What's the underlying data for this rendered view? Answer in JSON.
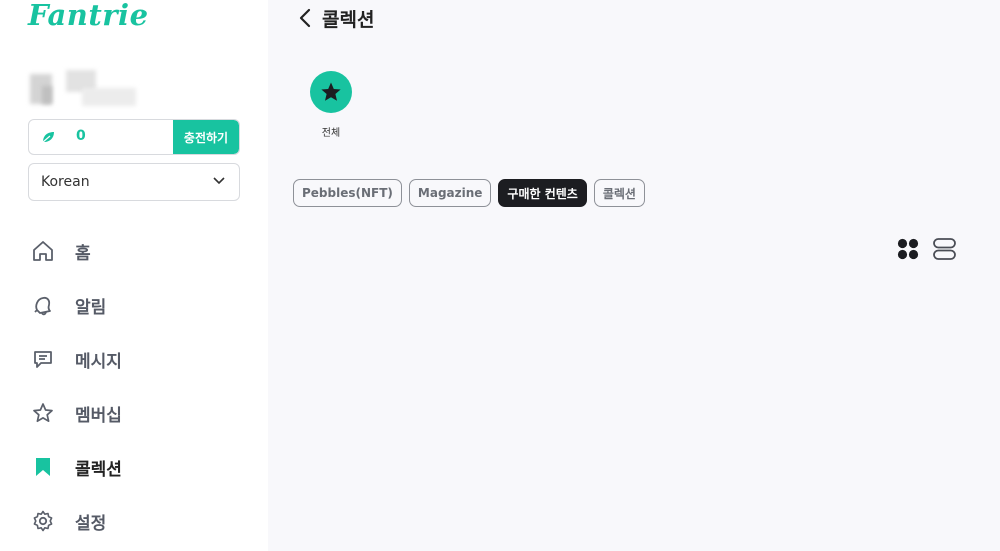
{
  "brand": {
    "logo_text": "Fantrie",
    "accent": "#18c3a0"
  },
  "wallet": {
    "balance": "0",
    "charge_label": "충전하기",
    "icon": "leaf-icon"
  },
  "language": {
    "selected": "Korean"
  },
  "nav": {
    "items": [
      {
        "label": "홈",
        "icon": "home-icon"
      },
      {
        "label": "알림",
        "icon": "bell-icon"
      },
      {
        "label": "메시지",
        "icon": "message-icon"
      },
      {
        "label": "멤버십",
        "icon": "star-outline-icon"
      },
      {
        "label": "콜렉션",
        "icon": "bookmark-icon",
        "active": true
      },
      {
        "label": "설정",
        "icon": "gear-icon"
      }
    ]
  },
  "page": {
    "title": "콜렉션"
  },
  "category": {
    "label": "전체",
    "icon": "star-icon"
  },
  "tabs": [
    {
      "label": "Pebbles(NFT)"
    },
    {
      "label": "Magazine"
    },
    {
      "label": "구매한 컨텐츠",
      "active": true
    },
    {
      "label": "콜렉션"
    }
  ],
  "view_toggles": {
    "grid": "grid-view-icon",
    "list": "list-view-icon"
  }
}
